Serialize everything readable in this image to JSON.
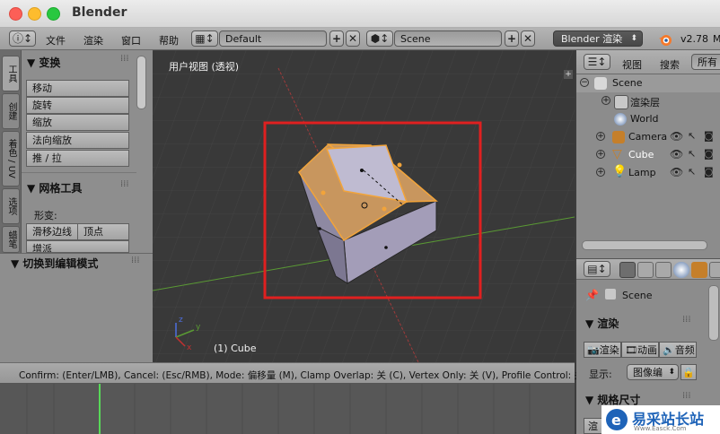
{
  "window": {
    "title": "Blender"
  },
  "infobar": {
    "menu": [
      "文件",
      "渲染",
      "窗口",
      "帮助"
    ],
    "layout_value": "Default",
    "scene_value": "Scene",
    "engine_value": "Blender 渲染",
    "version": "v2.78"
  },
  "toolshelf": {
    "tabs": [
      "工具",
      "创建",
      "着色 / UV",
      "选项",
      "蜡笔"
    ],
    "transform_title": "▼ 变换",
    "transform_buttons": [
      "移动",
      "旋转",
      "缩放",
      "法向缩放",
      "推 / 拉"
    ],
    "mesh_title": "▼ 网格工具",
    "deform_label": "形变:",
    "slide_edge": "滑移边线",
    "vertex": "顶点",
    "smooth_partial": "增派"
  },
  "operator_panel": {
    "title": "▼ 切换到编辑模式"
  },
  "viewport": {
    "title": "用户视图 (透视)",
    "object_label": "(1) Cube",
    "axis_x": "x",
    "axis_y": "y",
    "axis_z": "z"
  },
  "statusbar": {
    "text": "Confirm: (Enter/LMB), Cancel: (Esc/RMB), Mode: 偏移量 (M), Clamp Overlap: 关 (C), Vertex Only: 关 (V), Profile Control: 关 (P),"
  },
  "outliner": {
    "view_menu": "视图",
    "search_menu": "搜索",
    "all_scenes": "所有",
    "tree": [
      {
        "label": "Scene"
      },
      {
        "label": "渲染层"
      },
      {
        "label": "World"
      },
      {
        "label": "Camera"
      },
      {
        "label": "Cube"
      },
      {
        "label": "Lamp"
      }
    ]
  },
  "properties": {
    "context_label": "Scene",
    "render_title": "▼ 渲染",
    "render_button": "渲染",
    "animation_button": "动画",
    "audio_button": "音频",
    "display_label": "显示:",
    "display_value": "图像编",
    "dimensions_title": "▼ 规格尺寸",
    "bottom_button": "渲"
  },
  "watermark": {
    "brand": "易采站长站",
    "sub": "Www.Easck.Com"
  },
  "colors": {
    "highlight_box": "#e02020",
    "selection_orange": "#f2a43a",
    "active_tab": "#6e6e6e",
    "grid_line": "#454545"
  }
}
